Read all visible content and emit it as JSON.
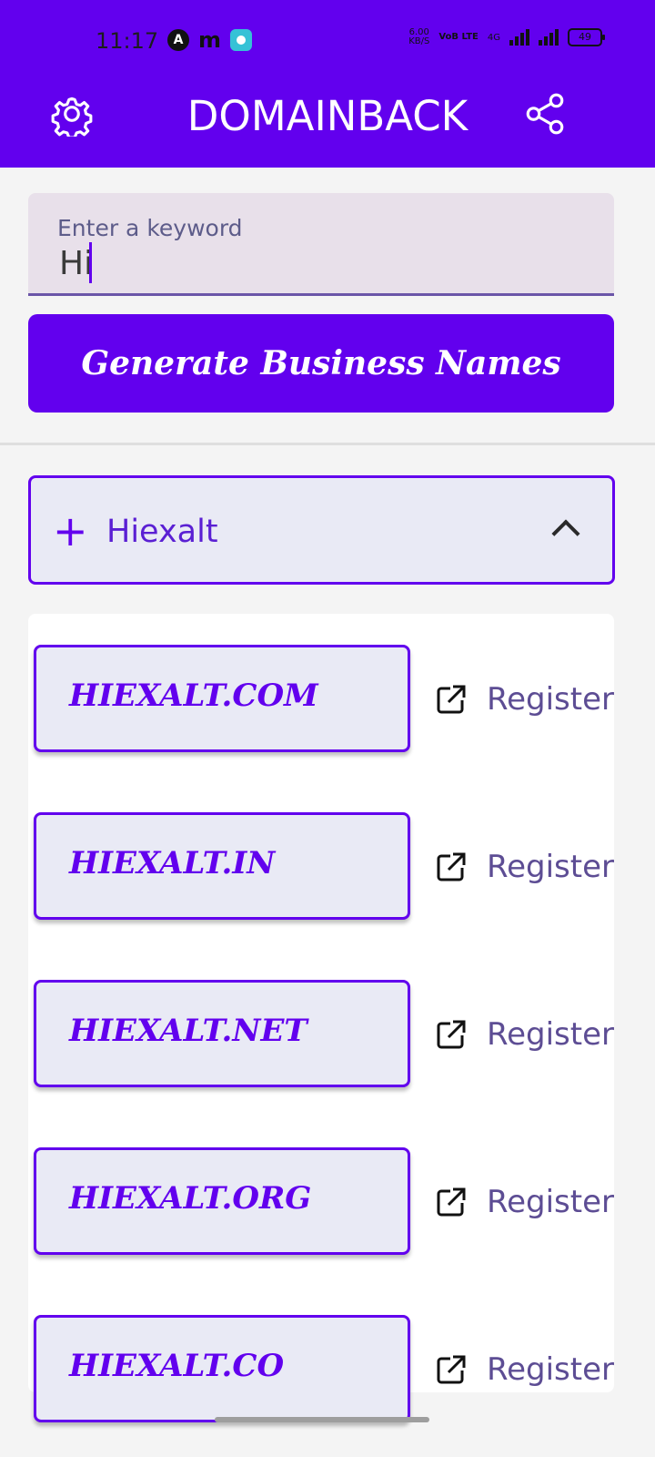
{
  "status": {
    "time": "11:17",
    "speed": "6.00",
    "speed_unit": "KB/S",
    "volte": "VoB LTE",
    "net": "4G",
    "battery": "49"
  },
  "appbar": {
    "title": "DOMAINBACK",
    "settings_icon": "gear-icon",
    "share_icon": "share-icon"
  },
  "search": {
    "label": "Enter a keyword",
    "value": "Hi"
  },
  "actions": {
    "generate_label": "Generate Business Names"
  },
  "keyword_card": {
    "name": "Hiexalt"
  },
  "domains": [
    {
      "name": "HIEXALT.COM",
      "action": "Register"
    },
    {
      "name": "HIEXALT.IN",
      "action": "Register"
    },
    {
      "name": "HIEXALT.NET",
      "action": "Register"
    },
    {
      "name": "HIEXALT.ORG",
      "action": "Register"
    },
    {
      "name": "HIEXALT.CO",
      "action": "Register"
    }
  ],
  "colors": {
    "primary": "#6200ee",
    "background": "#f4f4f4",
    "card": "#e9eaf5",
    "register": "#5d4d94"
  }
}
